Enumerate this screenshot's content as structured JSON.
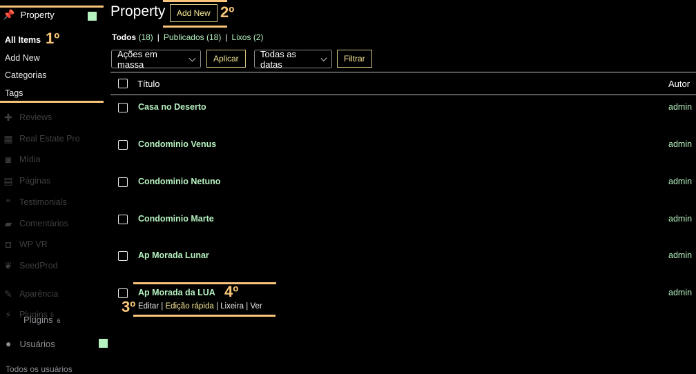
{
  "sidebar": {
    "current": {
      "label": "Property"
    },
    "submenu": [
      {
        "label": "All Items",
        "active": true
      },
      {
        "label": "Add New"
      },
      {
        "label": "Categorias"
      },
      {
        "label": "Tags"
      }
    ],
    "menu": [
      {
        "label": "Reviews",
        "icon": "pin-icon"
      },
      {
        "label": "Real Estate Pro",
        "icon": "building-icon"
      },
      {
        "label": "Mídia",
        "icon": "media-icon"
      },
      {
        "label": "Páginas",
        "icon": "pages-icon"
      },
      {
        "label": "Testimonials",
        "icon": "quote-icon"
      },
      {
        "label": "Comentários",
        "icon": "comment-icon"
      },
      {
        "label": "WP VR",
        "icon": "vr-icon"
      },
      {
        "label": "SeedProd",
        "icon": "leaf-icon"
      },
      {
        "label": "Aparência",
        "icon": "brush-icon"
      },
      {
        "label": "Plugins",
        "icon": "plugin-icon",
        "badge": "6"
      }
    ],
    "ghost_plugins": {
      "label": "Plugins",
      "badge": "6"
    },
    "users": {
      "label": "Usuários"
    },
    "users_sub_partial": "Todos os usuários"
  },
  "annotations": {
    "step1": "1º",
    "step2": "2º",
    "step3": "3º",
    "step4": "4º"
  },
  "header": {
    "title": "Property",
    "add_new": "Add New"
  },
  "filters": [
    {
      "label": "Todos",
      "count": "(18)",
      "active": true
    },
    {
      "label": "Publicados",
      "count": "(18)"
    },
    {
      "label": "Lixos",
      "count": "(2)"
    }
  ],
  "toolbar": {
    "bulk_actions": "Ações em massa",
    "apply": "Aplicar",
    "dates": "Todas as datas",
    "filter": "Filtrar"
  },
  "table": {
    "columns": {
      "title": "Título",
      "author": "Autor"
    },
    "rows": [
      {
        "title": "Casa no Deserto",
        "author": "admin"
      },
      {
        "title": "Condominio Venus",
        "author": "admin"
      },
      {
        "title": "Condominio Netuno",
        "author": "admin"
      },
      {
        "title": "Condominio Marte",
        "author": "admin"
      },
      {
        "title": "Ap Morada Lunar",
        "author": "admin"
      },
      {
        "title": "Ap Morada da LUA",
        "author": "admin"
      }
    ],
    "row_actions": {
      "edit": "Editar",
      "quick_edit": "Edição rápida",
      "trash": "Lixeira",
      "view": "Ver"
    }
  },
  "colors": {
    "accent_green": "#b6f2c0",
    "annotation_orange": "#f9c57a",
    "button_yellow": "#f6e896"
  }
}
